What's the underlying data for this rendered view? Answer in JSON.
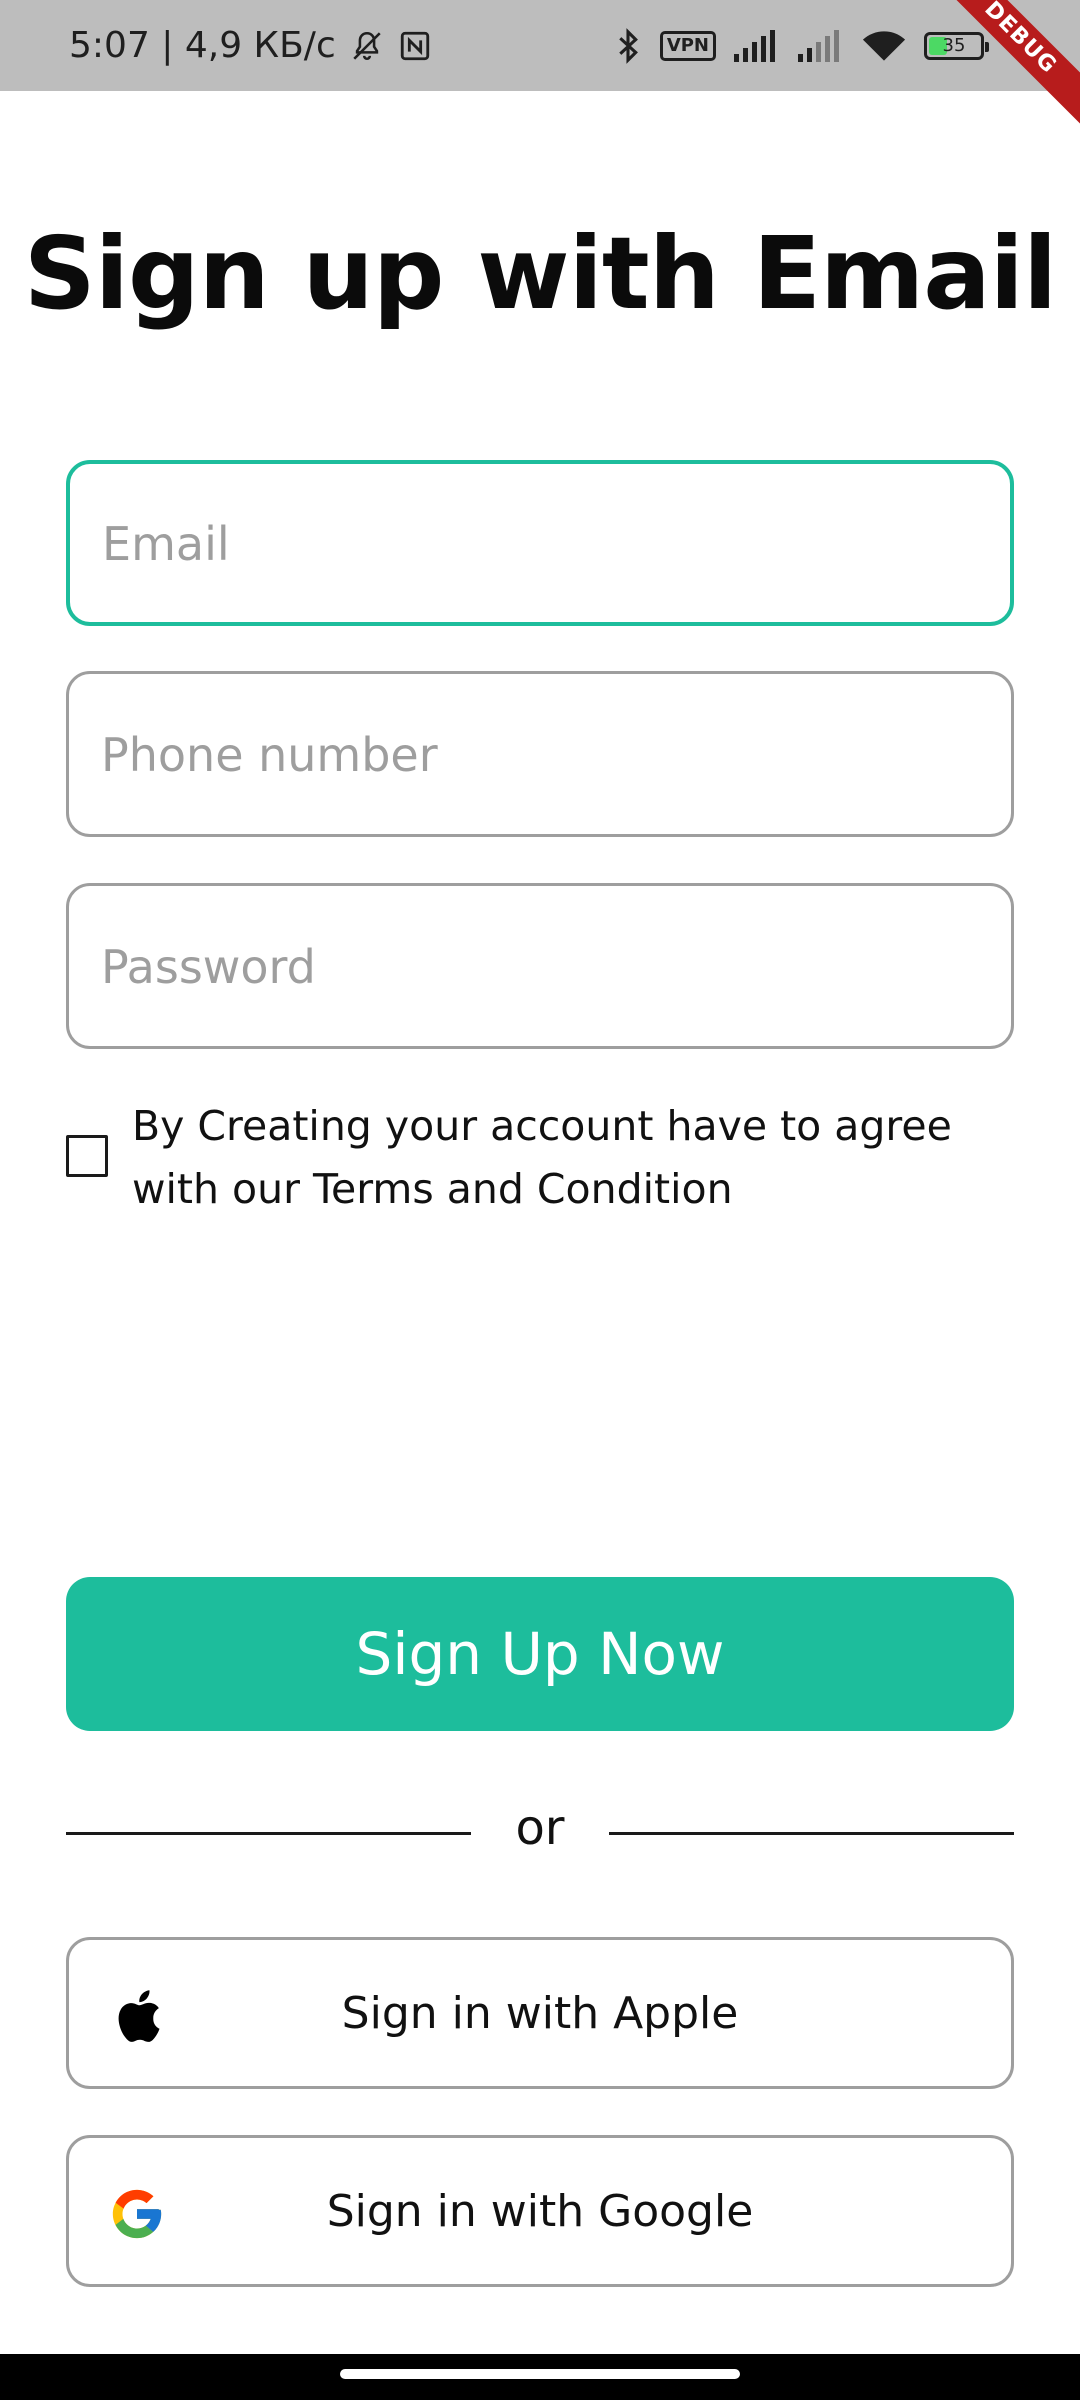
{
  "status_bar": {
    "time_speed": "5:07 | 4,9 КБ/с",
    "vpn_label": "VPN",
    "battery_level": "35",
    "icons": [
      "bell-off-icon",
      "nfc-icon",
      "bluetooth-icon",
      "vpn-icon",
      "signal-icon",
      "signal-icon",
      "wifi-icon",
      "battery-icon"
    ]
  },
  "debug_banner": "DEBUG",
  "title": "Sign up with Email",
  "form": {
    "email": {
      "placeholder": "Email",
      "value": ""
    },
    "phone": {
      "placeholder": "Phone number",
      "value": ""
    },
    "password": {
      "placeholder": "Password",
      "value": ""
    }
  },
  "terms": {
    "checked": false,
    "text": "By Creating your account have to agree with our Terms and Condition"
  },
  "primary_button": "Sign Up Now",
  "divider_text": "or",
  "social": {
    "apple": {
      "label": "Sign in with Apple",
      "icon": "apple-icon"
    },
    "google": {
      "label": "Sign in with Google",
      "icon": "google-icon"
    }
  },
  "colors": {
    "accent": "#1dbd9c",
    "border": "#9e9e9e",
    "status_bar": "#bdbdbd",
    "debug_banner": "#b71c1c"
  }
}
